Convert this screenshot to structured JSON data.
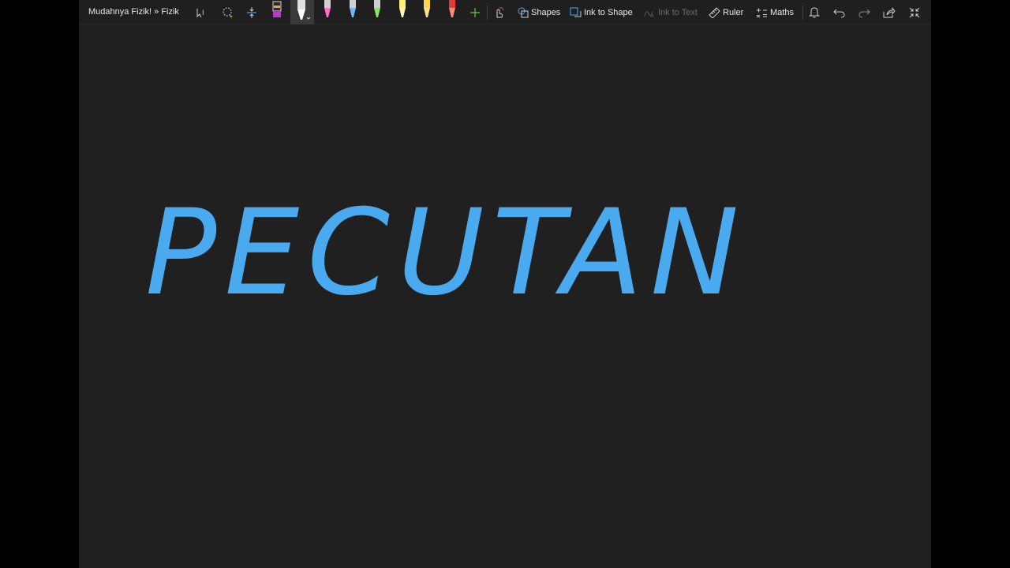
{
  "breadcrumb": "Mudahnya Fizik! » Fizik",
  "toolbar": {
    "shapes_label": "Shapes",
    "ink_to_shape_label": "Ink to Shape",
    "ink_to_text_label": "Ink to Text",
    "ruler_label": "Ruler",
    "maths_label": "Maths"
  },
  "pens": [
    {
      "name": "highlighter",
      "color": "#b03cc8"
    },
    {
      "name": "white-pen",
      "color": "#ffffff",
      "selected": true
    },
    {
      "name": "pink-pen",
      "color": "#ff6ec7"
    },
    {
      "name": "blue-pen",
      "color": "#6fb9ff"
    },
    {
      "name": "green-pen",
      "color": "#8be36b"
    },
    {
      "name": "yellow-pen",
      "color": "#fff176"
    },
    {
      "name": "gold-pen",
      "color": "#ffd54f"
    },
    {
      "name": "red-pen",
      "color": "#e53935"
    }
  ],
  "canvas": {
    "ink_text": "PECUTAN",
    "ink_color": "#4aaaf0"
  }
}
